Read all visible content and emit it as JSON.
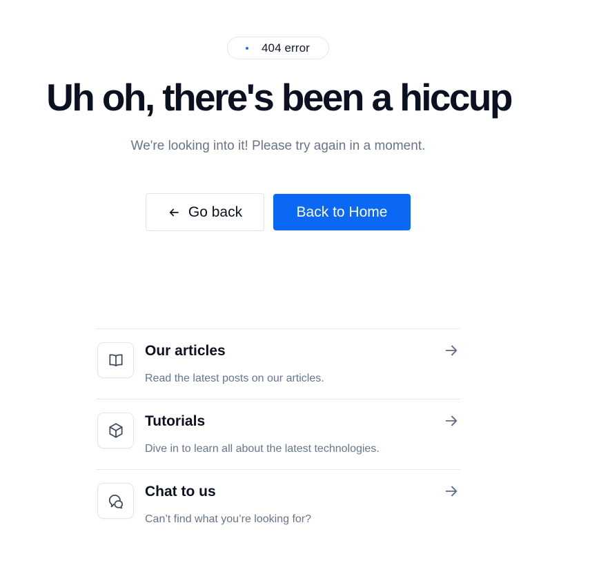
{
  "badge": {
    "label": "404 error",
    "dot_color": "#1e6ff5"
  },
  "hero": {
    "title": "Uh oh, there's been a hiccup",
    "subtitle": "We're looking into it! Please try again in a moment."
  },
  "actions": {
    "back_label": "Go back",
    "back_icon": "arrow-left-icon",
    "home_label": "Back to Home",
    "home_color": "#0a68f5"
  },
  "links": [
    {
      "icon": "book-open-icon",
      "title": "Our articles",
      "description": "Read the latest posts on our articles."
    },
    {
      "icon": "cube-icon",
      "title": "Tutorials",
      "description": "Dive in to learn all about the latest technologies."
    },
    {
      "icon": "chat-bubble-icon",
      "title": "Chat to us",
      "description": "Can’t find what you’re looking for?"
    }
  ]
}
